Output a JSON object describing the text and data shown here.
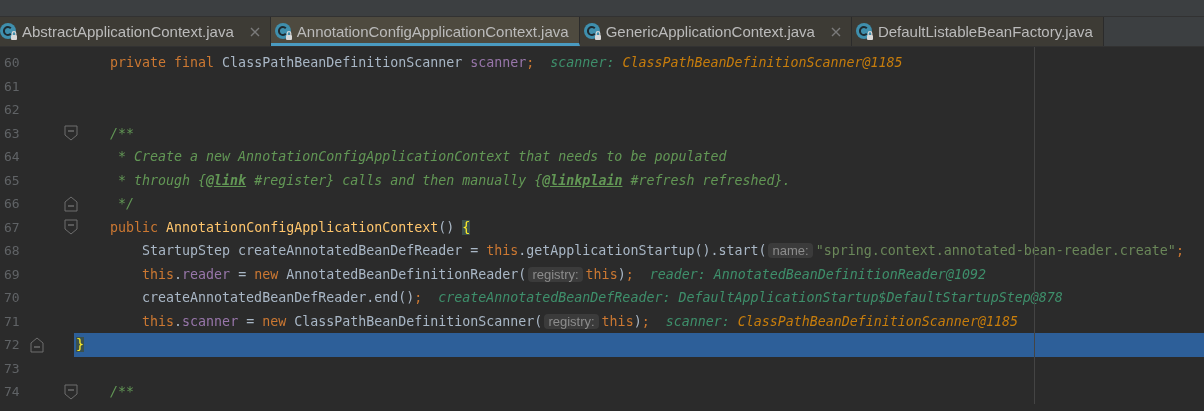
{
  "tabs": [
    {
      "label": "AbstractApplicationContext.java",
      "selected": false,
      "closable": true
    },
    {
      "label": "AnnotationConfigApplicationContext.java",
      "selected": true,
      "closable": false
    },
    {
      "label": "GenericApplicationContext.java",
      "selected": false,
      "closable": true
    },
    {
      "label": "DefaultListableBeanFactory.java",
      "selected": false,
      "closable": false
    }
  ],
  "editor": {
    "lines": [
      {
        "number": "60",
        "selected": false,
        "tokens": [
          {
            "kind": "keyword",
            "text": "    private final "
          },
          {
            "kind": "plain",
            "text": "ClassPathBeanDefinitionScanner "
          },
          {
            "kind": "field",
            "text": "scanner"
          },
          {
            "kind": "keyword",
            "text": ";"
          },
          {
            "kind": "debug-name",
            "text": "scanner:"
          },
          {
            "kind": "debug-changed",
            "text": "ClassPathBeanDefinitionScanner@1185"
          }
        ]
      },
      {
        "number": "61",
        "selected": false
      },
      {
        "number": "62",
        "selected": false
      },
      {
        "number": "63",
        "selected": false,
        "fold_start": true,
        "tokens": [
          {
            "kind": "comment",
            "text": "    /**"
          }
        ]
      },
      {
        "number": "64",
        "selected": false,
        "tokens": [
          {
            "kind": "comment",
            "text": "     * Create a new AnnotationConfigApplicationContext that needs to be populated"
          }
        ]
      },
      {
        "number": "65",
        "selected": false,
        "tokens": [
          {
            "kind": "comment",
            "text": "     * through {"
          },
          {
            "kind": "doc-tag",
            "text": "@link"
          },
          {
            "kind": "comment",
            "text": " #register} calls and then manually {"
          },
          {
            "kind": "doc-tag",
            "text": "@linkplain"
          },
          {
            "kind": "comment",
            "text": " #refresh refreshed}."
          }
        ]
      },
      {
        "number": "66",
        "selected": false,
        "fold_end": true,
        "tokens": [
          {
            "kind": "comment",
            "text": "     */"
          }
        ]
      },
      {
        "number": "67",
        "selected": false,
        "fold_start": true,
        "tokens": [
          {
            "kind": "keyword",
            "text": "    public "
          },
          {
            "kind": "method",
            "text": "AnnotationConfigApplicationContext"
          },
          {
            "kind": "plain",
            "text": "() "
          },
          {
            "kind": "brace",
            "text": "{"
          }
        ]
      },
      {
        "number": "68",
        "selected": false,
        "tokens": [
          {
            "kind": "plain",
            "text": "        StartupStep createAnnotatedBeanDefReader = "
          },
          {
            "kind": "keyword",
            "text": "this"
          },
          {
            "kind": "plain",
            "text": ".getApplicationStartup().start("
          },
          {
            "kind": "hint",
            "text": "name:"
          },
          {
            "kind": "string",
            "text": "\"spring.context.annotated-bean-reader.create\""
          },
          {
            "kind": "keyword",
            "text": ";"
          }
        ]
      },
      {
        "number": "69",
        "selected": false,
        "tokens": [
          {
            "kind": "keyword",
            "text": "        this"
          },
          {
            "kind": "plain",
            "text": "."
          },
          {
            "kind": "field",
            "text": "reader"
          },
          {
            "kind": "plain",
            "text": " = "
          },
          {
            "kind": "keyword",
            "text": "new "
          },
          {
            "kind": "plain",
            "text": "AnnotatedBeanDefinitionReader("
          },
          {
            "kind": "hint",
            "text": "registry:"
          },
          {
            "kind": "keyword",
            "text": "this"
          },
          {
            "kind": "plain",
            "text": ")"
          },
          {
            "kind": "keyword",
            "text": ";"
          },
          {
            "kind": "debug-name",
            "text": "reader:"
          },
          {
            "kind": "debug-value",
            "text": "AnnotatedBeanDefinitionReader@1092"
          }
        ]
      },
      {
        "number": "70",
        "selected": false,
        "tokens": [
          {
            "kind": "plain",
            "text": "        createAnnotatedBeanDefReader.end()"
          },
          {
            "kind": "keyword",
            "text": ";"
          },
          {
            "kind": "debug-name",
            "text": "createAnnotatedBeanDefReader:"
          },
          {
            "kind": "debug-value",
            "text": "DefaultApplicationStartup$DefaultStartupStep@878"
          }
        ]
      },
      {
        "number": "71",
        "selected": false,
        "tokens": [
          {
            "kind": "keyword",
            "text": "        this"
          },
          {
            "kind": "plain",
            "text": "."
          },
          {
            "kind": "field",
            "text": "scanner"
          },
          {
            "kind": "plain",
            "text": " = "
          },
          {
            "kind": "keyword",
            "text": "new "
          },
          {
            "kind": "plain",
            "text": "ClassPathBeanDefinitionScanner("
          },
          {
            "kind": "hint",
            "text": "registry:"
          },
          {
            "kind": "keyword",
            "text": "this"
          },
          {
            "kind": "plain",
            "text": ")"
          },
          {
            "kind": "keyword",
            "text": ";"
          },
          {
            "kind": "debug-name",
            "text": "scanner:"
          },
          {
            "kind": "debug-changed",
            "text": "ClassPathBeanDefinitionScanner@1185"
          }
        ]
      },
      {
        "number": "72",
        "selected": true,
        "fold_end": true,
        "tokens": [
          {
            "kind": "brace",
            "text": "    }"
          }
        ]
      },
      {
        "number": "73",
        "selected": false
      },
      {
        "number": "74",
        "selected": false,
        "fold_start": true,
        "tokens": [
          {
            "kind": "comment",
            "text": "    /**"
          }
        ]
      }
    ]
  }
}
